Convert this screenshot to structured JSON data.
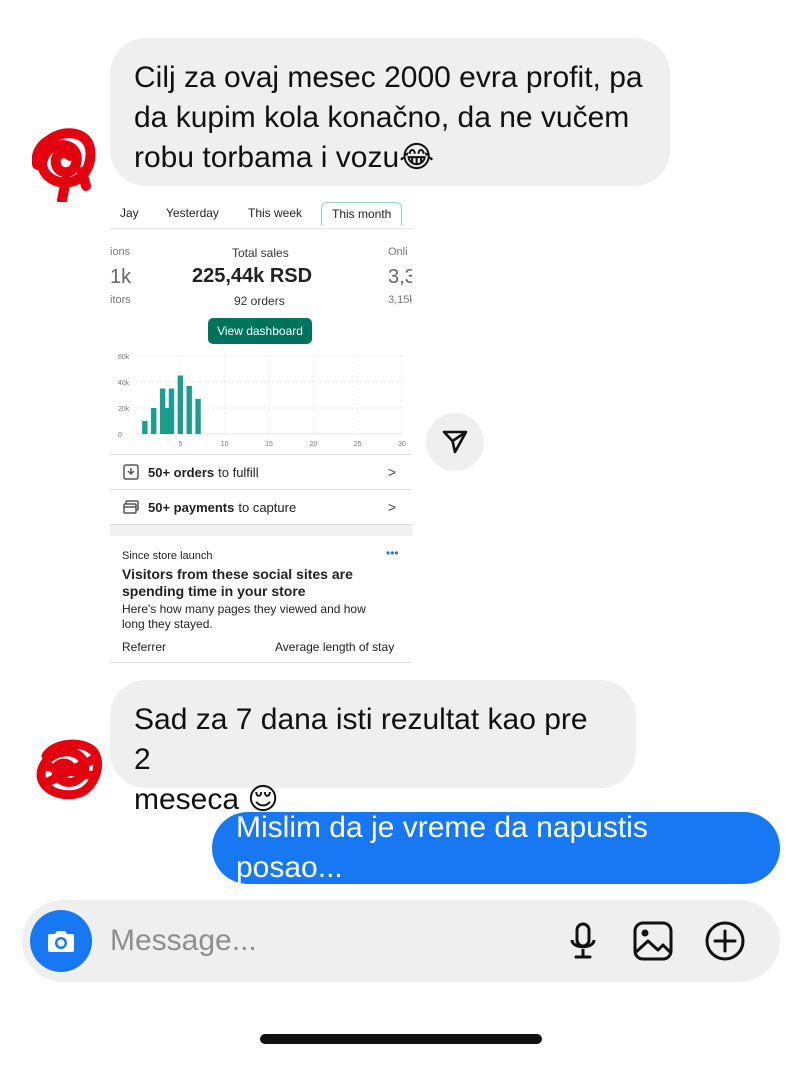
{
  "messages": {
    "m1_line1": "Cilj za ovaj mesec 2000 evra profit, pa",
    "m1_line2": "da kupim kola konačno, da ne vučem",
    "m1_line3": "robu torbama i vozu😂",
    "m2_line1": "Sad za 7 dana isti rezultat kao pre 2",
    "m2_line2": "meseca 😌",
    "m3": "Mislim da je vreme da napustis posao..."
  },
  "shared_screenshot": {
    "tabs": [
      "Jay",
      "Yesterday",
      "This week",
      "This month"
    ],
    "active_tab": "This month",
    "left_metric": {
      "label": "ions",
      "value": "1k",
      "sub": "itors"
    },
    "center_metric": {
      "label": "Total sales",
      "value": "225,44k RSD",
      "sub": "92 orders"
    },
    "right_metric": {
      "label": "Onli",
      "value": "3,3",
      "sub": "3,15k"
    },
    "dashboard_button": "View dashboard",
    "orders_row": {
      "bold": "50+ orders",
      "rest": "to fulfill"
    },
    "payments_row": {
      "bold": "50+ payments",
      "rest": "to capture"
    },
    "card": {
      "since": "Since store launch",
      "more": "•••",
      "title_line1": "Visitors from these social sites are",
      "title_line2": "spending time in your store",
      "desc_line1": "Here's how many pages they viewed and how",
      "desc_line2": "long they stayed.",
      "col1": "Referrer",
      "col2": "Average length of stay"
    }
  },
  "chart_data": {
    "type": "bar",
    "x": [
      1,
      2,
      3,
      4,
      5,
      6,
      7
    ],
    "values": [
      10000,
      20000,
      35000,
      20000,
      35000,
      45000,
      37000,
      27000
    ],
    "bars": [
      {
        "day": 1,
        "value": 10000
      },
      {
        "day": 2,
        "value": 20000
      },
      {
        "day": 3,
        "value": 35000
      },
      {
        "day": 3.5,
        "value": 20000
      },
      {
        "day": 4,
        "value": 35000
      },
      {
        "day": 5,
        "value": 45000
      },
      {
        "day": 6,
        "value": 37000
      },
      {
        "day": 7,
        "value": 27000
      }
    ],
    "y_ticks": [
      "0",
      "20k",
      "40k",
      "60k"
    ],
    "x_ticks": [
      "5",
      "10",
      "15",
      "20",
      "25",
      "30"
    ],
    "ylim": [
      0,
      60000
    ],
    "xlim": [
      0,
      30
    ],
    "color": "#1a9e8f",
    "grid": true
  },
  "composer": {
    "placeholder": "Message...",
    "icons": [
      "camera-icon",
      "microphone-icon",
      "gallery-icon",
      "plus-circle-icon"
    ]
  },
  "colors": {
    "accent": "#1877f2",
    "incoming_bubble": "#efefef",
    "shopify_green": "#00735c"
  }
}
